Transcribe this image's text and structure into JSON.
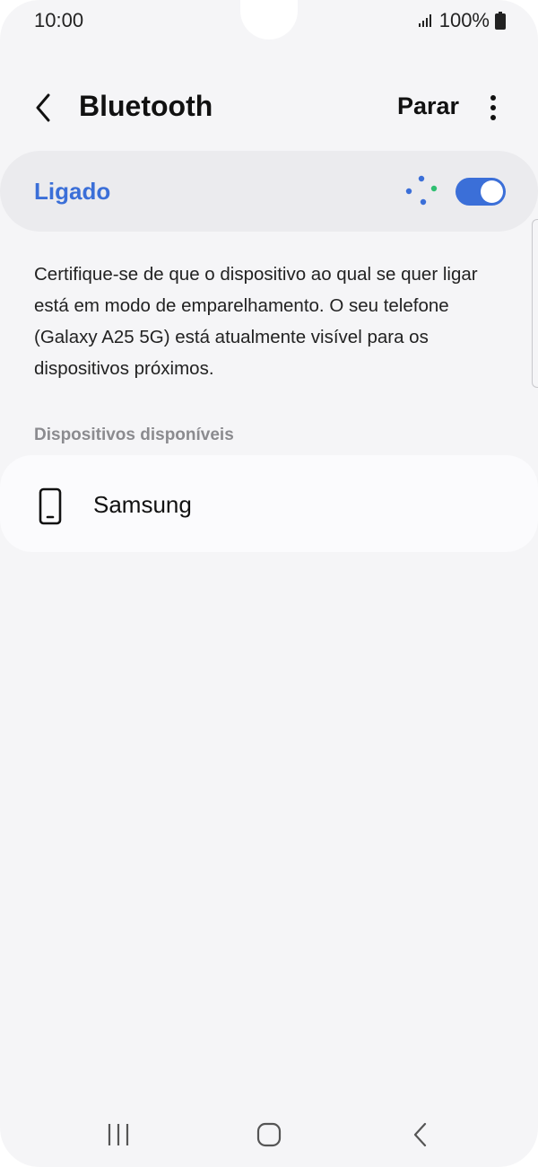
{
  "status_bar": {
    "time": "10:00",
    "battery": "100%",
    "icons": [
      "signal-icon",
      "battery-icon"
    ]
  },
  "header": {
    "title": "Bluetooth",
    "stop_label": "Parar",
    "icons": [
      "back-arrow-icon",
      "more-options-icon"
    ]
  },
  "toggle": {
    "label": "Ligado",
    "state": "on",
    "accent_color": "#3b6fd8"
  },
  "description": "Certifique-se de que o dispositivo ao qual se quer ligar está em modo de emparelhamento. O seu telefone (Galaxy A25 5G) está atualmente visível para os dispositivos próximos.",
  "available_devices": {
    "header": "Dispositivos disponíveis",
    "items": [
      {
        "name": "Samsung",
        "icon": "smartphone-icon"
      }
    ]
  },
  "nav_bar": {
    "icons": [
      "recent-apps-icon",
      "home-icon",
      "back-icon"
    ]
  }
}
